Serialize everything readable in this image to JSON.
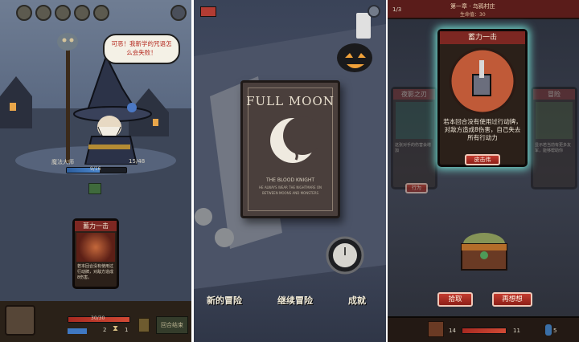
{
  "panel1": {
    "speech_text": "可恶！我新学的咒语怎么会失败！",
    "enemy_name": "魔法大师",
    "enemy_status_right": "15/48",
    "enemy_hp_text": "9/16",
    "player_hp_text": "30/30",
    "player_stat_left": "2",
    "player_stat_right": "1",
    "end_turn_label": "回合结束",
    "card": {
      "title": "蓄力一击",
      "text": "若本回合没有使用过行动牌，对敌方造成8伤害。"
    },
    "colors": {
      "hp": "#c43c30",
      "mana": "#3f78c2",
      "accent": "#7d2722"
    },
    "icons": [
      "skull-icon",
      "helmet-icon",
      "claw-icon",
      "crest-icon",
      "moon-icon",
      "gear-icon",
      "hourglass-icon",
      "chest-icon"
    ]
  },
  "panel2": {
    "book_title": "FULL MOON",
    "book_subtitle": "THE BLOOD KNIGHT",
    "book_small_1": "HE ALWAYS WEAR THE NIGHTMARE ON",
    "book_small_2": "BETWEEN MOONS AND MONSTERS",
    "buttons": [
      "新的冒险",
      "继续冒险",
      "成就"
    ],
    "icons": [
      "camera-icon",
      "settings-icon",
      "pumpkin-icon",
      "pocket-watch-icon",
      "moon-emblem-icon",
      "candle-icon"
    ]
  },
  "panel3": {
    "header_title": "第一章 · 乌鸦村庄",
    "header_sub": "生命值：30",
    "header_left": "1/3",
    "card": {
      "title": "蓄力一击",
      "text": "若本回合没有使用过行动牌，对敌方造成8伤害，自己失去所有行动力",
      "button": "皮击伟"
    },
    "bg_card_left_title": "夜影之刃",
    "bg_card_left_text": "这张对手的伤害会增加",
    "bg_card_right_title": "冒险",
    "bg_card_right_text": "显示若当前有更多友军，能够帮助你",
    "bg_card_left_btn": "行为",
    "take_label": "拾取",
    "think_label": "再想想",
    "bottom_left": "14",
    "bottom_mid": "11",
    "bottom_right": "5",
    "icons": [
      "chest-icon",
      "crest-icon",
      "potion-icon"
    ]
  }
}
